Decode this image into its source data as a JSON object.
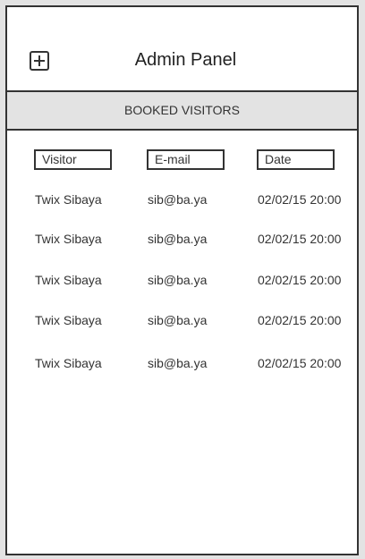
{
  "header": {
    "title": "Admin Panel",
    "add_icon": "plus-square-icon"
  },
  "section": {
    "label": "BOOKED VISITORS"
  },
  "table": {
    "columns": [
      "Visitor",
      "E-mail",
      "Date"
    ],
    "rows": [
      [
        "Twix Sibaya",
        "sib@ba.ya",
        "02/02/15 20:00"
      ],
      [
        "Twix Sibaya",
        "sib@ba.ya",
        "02/02/15 20:00"
      ],
      [
        "Twix Sibaya",
        "sib@ba.ya",
        "02/02/15 20:00"
      ],
      [
        "Twix Sibaya",
        "sib@ba.ya",
        "02/02/15 20:00"
      ],
      [
        "Twix Sibaya",
        "sib@ba.ya",
        "02/02/15 20:00"
      ]
    ]
  }
}
